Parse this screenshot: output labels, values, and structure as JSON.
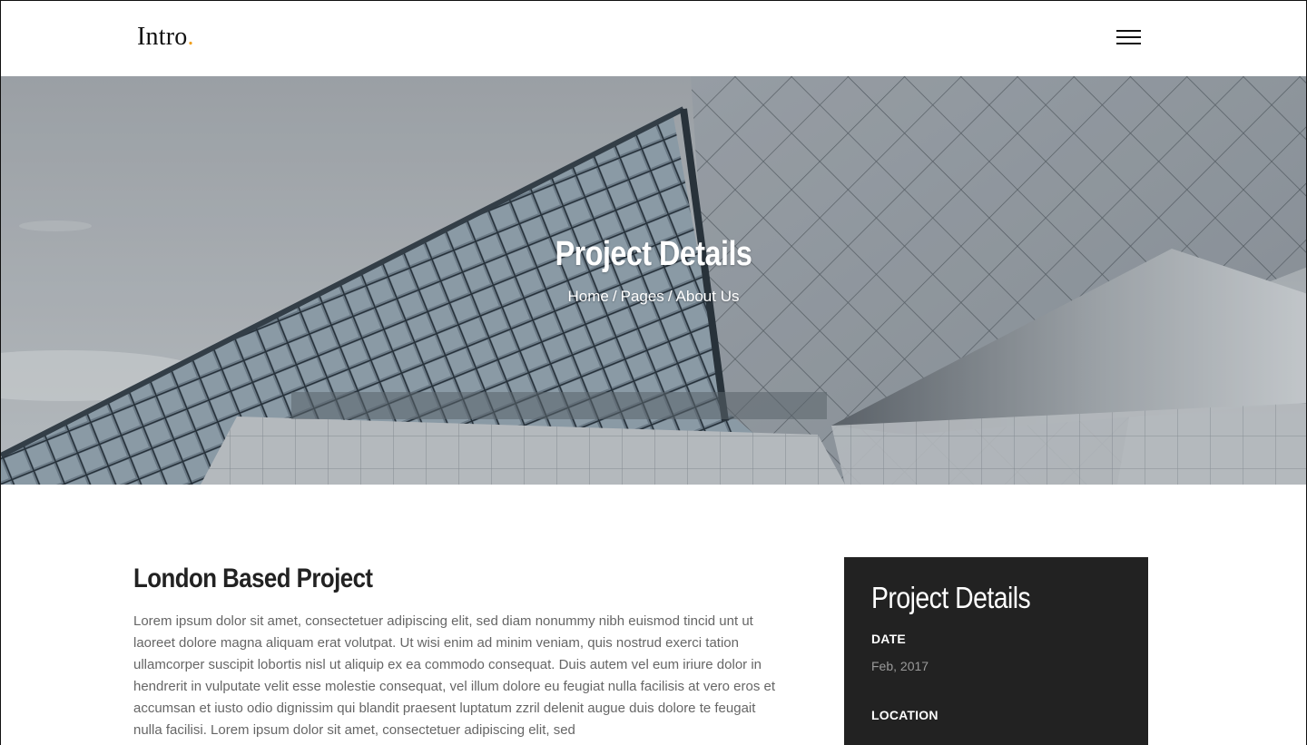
{
  "header": {
    "logo_text": "Intro",
    "logo_dot": ".",
    "menu_icon": "hamburger-menu-icon",
    "accent_color": "#f0a020"
  },
  "hero": {
    "title": "Project Details",
    "breadcrumb": {
      "home": "Home",
      "pages": "Pages",
      "current": "About Us",
      "separator": "/"
    }
  },
  "article": {
    "title": "London Based Project",
    "body": "Lorem ipsum dolor sit amet, consectetuer adipiscing elit, sed diam nonummy nibh euismod tincid unt ut laoreet dolore magna aliquam erat volutpat. Ut wisi enim ad minim veniam, quis nostrud exerci tation ullamcorper suscipit lobortis nisl ut aliquip ex ea commodo consequat. Duis autem vel eum iriure dolor in hendrerit in vulputate velit esse molestie consequat, vel illum dolore eu feugiat nulla facilisis at vero eros et accumsan et iusto odio dignissim qui blandit praesent luptatum zzril delenit augue duis dolore te feugait nulla facilisi. Lorem ipsum dolor sit amet, consectetuer adipiscing elit, sed"
  },
  "details_card": {
    "title": "Project Details",
    "date_label": "DATE",
    "date_value": "Feb, 2017",
    "location_label": "LOCATION"
  }
}
